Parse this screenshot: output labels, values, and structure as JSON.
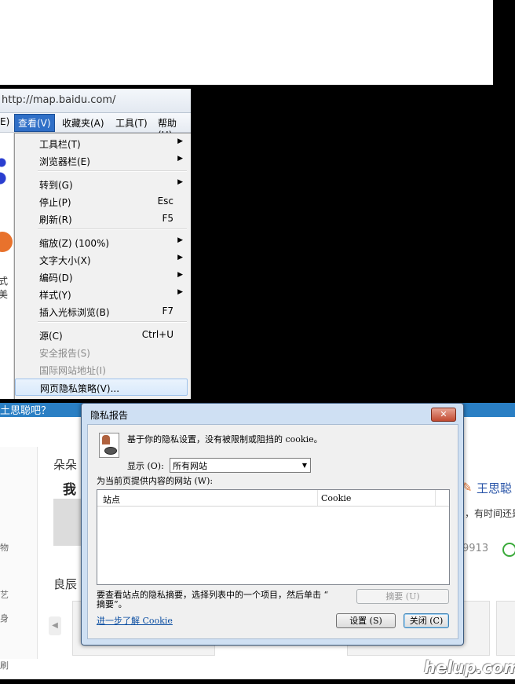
{
  "browser": {
    "address_url": "http://map.baidu.com/",
    "menubar": [
      {
        "label": "E)"
      },
      {
        "label": "查看(V)"
      },
      {
        "label": "收藏夹(A)"
      },
      {
        "label": "工具(T)"
      },
      {
        "label": "帮助(H)"
      }
    ]
  },
  "view_menu": {
    "items": [
      {
        "label": "工具栏(T)",
        "submenu": true
      },
      {
        "label": "浏览器栏(E)",
        "submenu": true
      },
      {
        "label": "转到(G)",
        "submenu": true
      },
      {
        "label": "停止(P)",
        "shortcut": "Esc"
      },
      {
        "label": "刷新(R)",
        "shortcut": "F5"
      },
      {
        "label": "缩放(Z) (100%)",
        "submenu": true
      },
      {
        "label": "文字大小(X)",
        "submenu": true
      },
      {
        "label": "编码(D)",
        "submenu": true
      },
      {
        "label": "样式(Y)",
        "submenu": true
      },
      {
        "label": "插入光标浏览(B)",
        "shortcut": "F7"
      },
      {
        "label": "源(C)",
        "shortcut": "Ctrl+U"
      },
      {
        "label": "安全报告(S)",
        "disabled": true
      },
      {
        "label": "国际网站地址(I)",
        "disabled": true
      },
      {
        "label": "网页隐私策略(V)...",
        "highlighted": true
      }
    ]
  },
  "background_page": {
    "banner_text": "土思聪吧？",
    "left_texts": [
      "式美",
      "物",
      "艺",
      "身",
      "刷"
    ],
    "post_title": "朵朵",
    "post_snippet": "我",
    "section_title": "良辰",
    "right_name": "王思聪",
    "right_snippet": "，有时间还是",
    "right_count": "9913"
  },
  "dialog": {
    "title": "隐私报告",
    "close_glyph": "✕",
    "message": "基于你的隐私设置，没有被限制或阻挡的 cookie。",
    "show_label": "显示 (O):",
    "show_value": "所有网站",
    "list_caption": "为当前页提供内容的网站 (W):",
    "col_site": "站点",
    "col_cookie": "Cookie",
    "hint_line1": "要查看站点的隐私摘要，选择列表中的一个项目，然后单击 “",
    "hint_line2": "摘要”。",
    "summary_button": "摘要 (U)",
    "learn_link": "进一步了解 Cookie",
    "settings_button": "设置 (S)",
    "close_button": "关闭 (C)"
  },
  "watermark": "helup.com"
}
